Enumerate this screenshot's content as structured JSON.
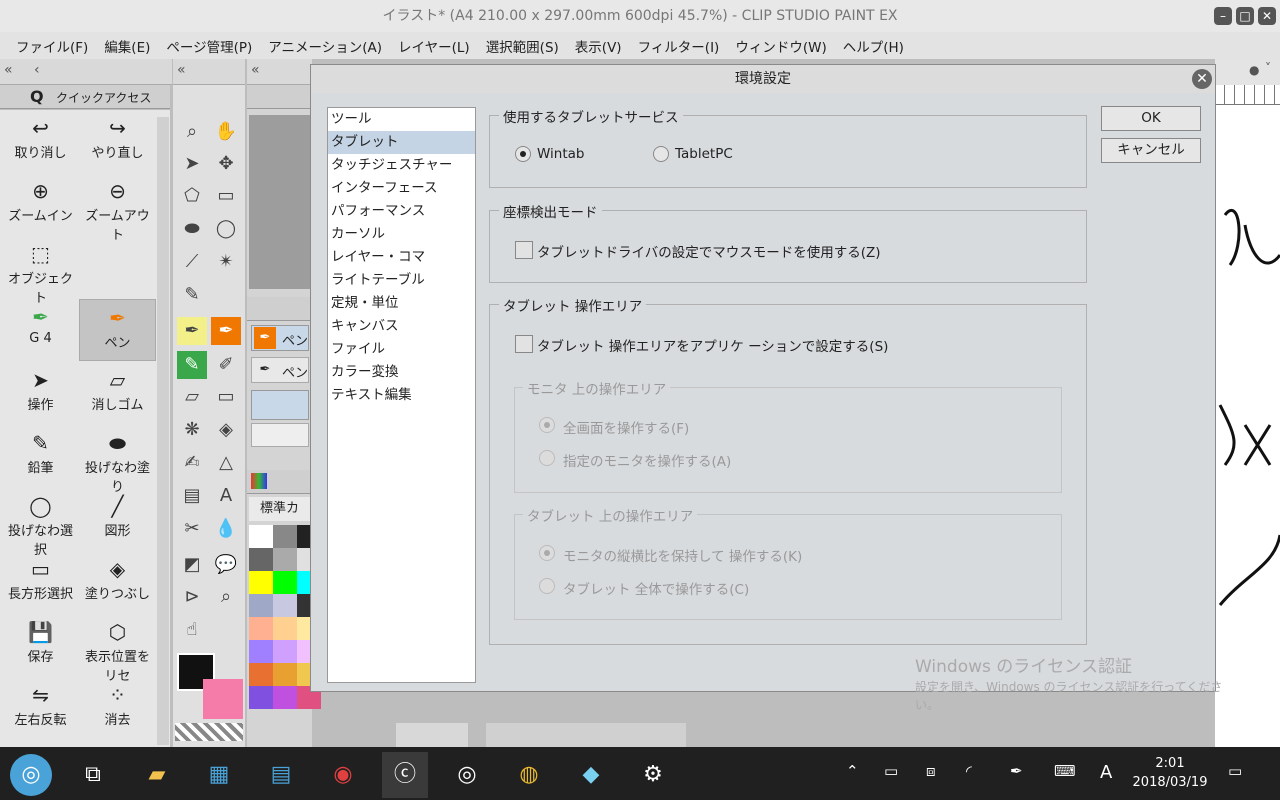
{
  "window": {
    "title": "イラスト* (A4 210.00 x 297.00mm 600dpi 45.7%) - CLIP STUDIO PAINT EX",
    "buttons": [
      "minimize",
      "maximize",
      "close"
    ]
  },
  "menu": [
    "ファイル(F)",
    "編集(E)",
    "ページ管理(P)",
    "アニメーション(A)",
    "レイヤー(L)",
    "選択範囲(S)",
    "表示(V)",
    "フィルター(I)",
    "ウィンドウ(W)",
    "ヘルプ(H)"
  ],
  "quick_access": {
    "tab_label": "クイックアクセス",
    "items": [
      {
        "label": "取り消し",
        "icon": "undo-icon",
        "glyph": "↩"
      },
      {
        "label": "やり直し",
        "icon": "redo-icon",
        "glyph": "↪"
      },
      {
        "label": "ズームイン",
        "icon": "zoom-in-icon",
        "glyph": "⊕"
      },
      {
        "label": "ズームアウト",
        "icon": "zoom-out-icon",
        "glyph": "⊖"
      },
      {
        "label": "オブジェクト",
        "icon": "object-icon",
        "glyph": "⬚"
      },
      {
        "label": "",
        "icon": "",
        "glyph": ""
      },
      {
        "label": "G 4",
        "icon": "g-pen-icon",
        "glyph": "✒"
      },
      {
        "label": "ペン",
        "icon": "pen-icon",
        "glyph": "✒"
      },
      {
        "label": "操作",
        "icon": "operation-icon",
        "glyph": "➤"
      },
      {
        "label": "消しゴム",
        "icon": "eraser-icon",
        "glyph": "▱"
      },
      {
        "label": "鉛筆",
        "icon": "pencil-icon",
        "glyph": "✎"
      },
      {
        "label": "投げなわ塗り",
        "icon": "lasso-fill-icon",
        "glyph": "⬬"
      },
      {
        "label": "投げなわ選択",
        "icon": "lasso-select-icon",
        "glyph": "◯"
      },
      {
        "label": "図形",
        "icon": "figure-icon",
        "glyph": "╱"
      },
      {
        "label": "長方形選択",
        "icon": "rect-select-icon",
        "glyph": "▭"
      },
      {
        "label": "塗りつぶし",
        "icon": "fill-icon",
        "glyph": "◈"
      },
      {
        "label": "保存",
        "icon": "save-icon",
        "glyph": "💾"
      },
      {
        "label": "表示位置をリセ",
        "icon": "reset-view-icon",
        "glyph": "⬡"
      },
      {
        "label": "左右反転",
        "icon": "flip-icon",
        "glyph": "⇋"
      },
      {
        "label": "消去",
        "icon": "clear-icon",
        "glyph": "⁘"
      }
    ]
  },
  "color_panel": {
    "tab_label": "標準カ"
  },
  "dialog": {
    "title": "環境設定",
    "categories": [
      "ツール",
      "タブレット",
      "タッチジェスチャー",
      "インターフェース",
      "パフォーマンス",
      "カーソル",
      "レイヤー・コマ",
      "ライトテーブル",
      "定規・単位",
      "キャンバス",
      "ファイル",
      "カラー変換",
      "テキスト編集"
    ],
    "selected_category": "タブレット",
    "tablet_service": {
      "group_label": "使用するタブレットサービス",
      "options": [
        "Wintab",
        "TabletPC"
      ],
      "selected": "Wintab"
    },
    "coord_mode": {
      "group_label": "座標検出モード",
      "checkbox_label": "タブレットドライバの設定でマウスモードを使用する(Z)",
      "checked": false
    },
    "tablet_area": {
      "group_label": "タブレット 操作エリア",
      "checkbox_label": "タブレット 操作エリアをアプリケ ーションで設定する(S)",
      "checked": false,
      "monitor_group": {
        "label": "モニタ 上の操作エリア",
        "options": [
          "全画面を操作する(F)",
          "指定のモニタを操作する(A)"
        ],
        "selected": "全画面を操作する(F)"
      },
      "tablet_group": {
        "label": "タブレット 上の操作エリア",
        "options": [
          "モニタの縦横比を保持して 操作する(K)",
          "タブレット 全体で操作する(C)"
        ],
        "selected": "モニタの縦横比を保持して 操作する(K)"
      }
    },
    "buttons": {
      "ok": "OK",
      "cancel": "キャンセル"
    }
  },
  "watermark": {
    "title": "Windows のライセンス認証",
    "body": "設定を開き、Windows のライセンス認証を行ってください。"
  },
  "taskbar": {
    "apps": [
      "file-explorer-icon",
      "store-icon",
      "news-icon",
      "photoscape-icon",
      "clip-studio-paint-icon",
      "clip-studio-icon",
      "chrome-icon",
      "notes-icon",
      "settings-icon"
    ],
    "ime": "A",
    "time": "2:01",
    "date": "2018/03/19"
  },
  "colors": {
    "dialog_bg": "#d8dbde",
    "selected_category": "#c4d4e4",
    "accent_orange": "#f07800",
    "taskbar": "#202020"
  }
}
